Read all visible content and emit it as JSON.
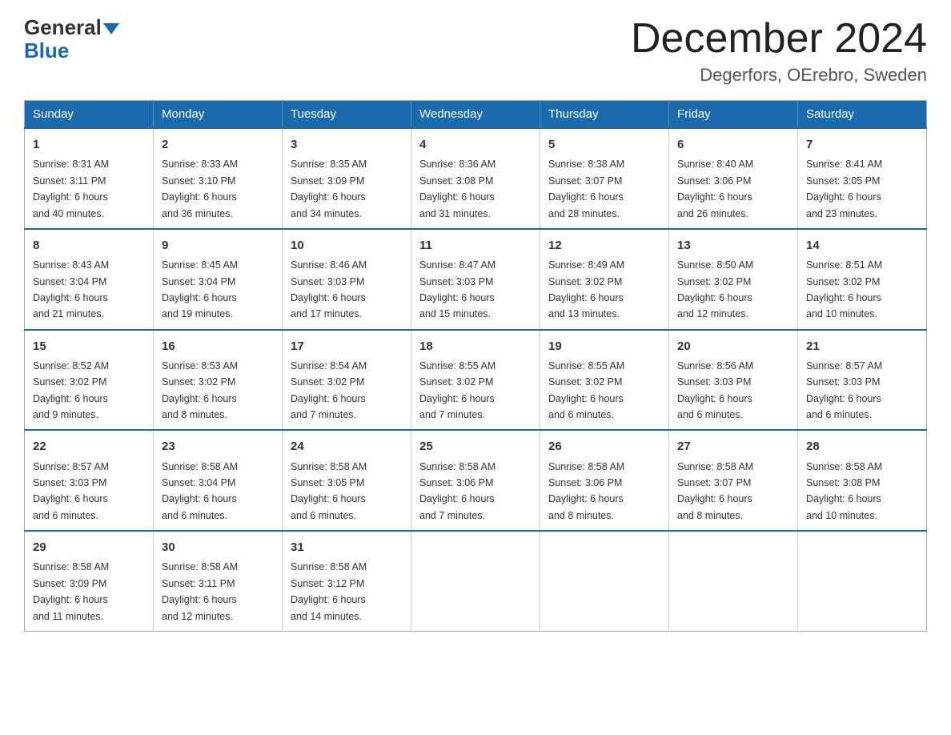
{
  "header": {
    "logo_general": "General",
    "logo_blue": "Blue",
    "month_title": "December 2024",
    "location": "Degerfors, OErebro, Sweden"
  },
  "days_of_week": [
    "Sunday",
    "Monday",
    "Tuesday",
    "Wednesday",
    "Thursday",
    "Friday",
    "Saturday"
  ],
  "weeks": [
    [
      {
        "day": "1",
        "sunrise": "8:31 AM",
        "sunset": "3:11 PM",
        "daylight": "6 hours and 40 minutes."
      },
      {
        "day": "2",
        "sunrise": "8:33 AM",
        "sunset": "3:10 PM",
        "daylight": "6 hours and 36 minutes."
      },
      {
        "day": "3",
        "sunrise": "8:35 AM",
        "sunset": "3:09 PM",
        "daylight": "6 hours and 34 minutes."
      },
      {
        "day": "4",
        "sunrise": "8:36 AM",
        "sunset": "3:08 PM",
        "daylight": "6 hours and 31 minutes."
      },
      {
        "day": "5",
        "sunrise": "8:38 AM",
        "sunset": "3:07 PM",
        "daylight": "6 hours and 28 minutes."
      },
      {
        "day": "6",
        "sunrise": "8:40 AM",
        "sunset": "3:06 PM",
        "daylight": "6 hours and 26 minutes."
      },
      {
        "day": "7",
        "sunrise": "8:41 AM",
        "sunset": "3:05 PM",
        "daylight": "6 hours and 23 minutes."
      }
    ],
    [
      {
        "day": "8",
        "sunrise": "8:43 AM",
        "sunset": "3:04 PM",
        "daylight": "6 hours and 21 minutes."
      },
      {
        "day": "9",
        "sunrise": "8:45 AM",
        "sunset": "3:04 PM",
        "daylight": "6 hours and 19 minutes."
      },
      {
        "day": "10",
        "sunrise": "8:46 AM",
        "sunset": "3:03 PM",
        "daylight": "6 hours and 17 minutes."
      },
      {
        "day": "11",
        "sunrise": "8:47 AM",
        "sunset": "3:03 PM",
        "daylight": "6 hours and 15 minutes."
      },
      {
        "day": "12",
        "sunrise": "8:49 AM",
        "sunset": "3:02 PM",
        "daylight": "6 hours and 13 minutes."
      },
      {
        "day": "13",
        "sunrise": "8:50 AM",
        "sunset": "3:02 PM",
        "daylight": "6 hours and 12 minutes."
      },
      {
        "day": "14",
        "sunrise": "8:51 AM",
        "sunset": "3:02 PM",
        "daylight": "6 hours and 10 minutes."
      }
    ],
    [
      {
        "day": "15",
        "sunrise": "8:52 AM",
        "sunset": "3:02 PM",
        "daylight": "6 hours and 9 minutes."
      },
      {
        "day": "16",
        "sunrise": "8:53 AM",
        "sunset": "3:02 PM",
        "daylight": "6 hours and 8 minutes."
      },
      {
        "day": "17",
        "sunrise": "8:54 AM",
        "sunset": "3:02 PM",
        "daylight": "6 hours and 7 minutes."
      },
      {
        "day": "18",
        "sunrise": "8:55 AM",
        "sunset": "3:02 PM",
        "daylight": "6 hours and 7 minutes."
      },
      {
        "day": "19",
        "sunrise": "8:55 AM",
        "sunset": "3:02 PM",
        "daylight": "6 hours and 6 minutes."
      },
      {
        "day": "20",
        "sunrise": "8:56 AM",
        "sunset": "3:03 PM",
        "daylight": "6 hours and 6 minutes."
      },
      {
        "day": "21",
        "sunrise": "8:57 AM",
        "sunset": "3:03 PM",
        "daylight": "6 hours and 6 minutes."
      }
    ],
    [
      {
        "day": "22",
        "sunrise": "8:57 AM",
        "sunset": "3:03 PM",
        "daylight": "6 hours and 6 minutes."
      },
      {
        "day": "23",
        "sunrise": "8:58 AM",
        "sunset": "3:04 PM",
        "daylight": "6 hours and 6 minutes."
      },
      {
        "day": "24",
        "sunrise": "8:58 AM",
        "sunset": "3:05 PM",
        "daylight": "6 hours and 6 minutes."
      },
      {
        "day": "25",
        "sunrise": "8:58 AM",
        "sunset": "3:06 PM",
        "daylight": "6 hours and 7 minutes."
      },
      {
        "day": "26",
        "sunrise": "8:58 AM",
        "sunset": "3:06 PM",
        "daylight": "6 hours and 8 minutes."
      },
      {
        "day": "27",
        "sunrise": "8:58 AM",
        "sunset": "3:07 PM",
        "daylight": "6 hours and 8 minutes."
      },
      {
        "day": "28",
        "sunrise": "8:58 AM",
        "sunset": "3:08 PM",
        "daylight": "6 hours and 10 minutes."
      }
    ],
    [
      {
        "day": "29",
        "sunrise": "8:58 AM",
        "sunset": "3:09 PM",
        "daylight": "6 hours and 11 minutes."
      },
      {
        "day": "30",
        "sunrise": "8:58 AM",
        "sunset": "3:11 PM",
        "daylight": "6 hours and 12 minutes."
      },
      {
        "day": "31",
        "sunrise": "8:58 AM",
        "sunset": "3:12 PM",
        "daylight": "6 hours and 14 minutes."
      },
      null,
      null,
      null,
      null
    ]
  ],
  "labels": {
    "sunrise": "Sunrise:",
    "sunset": "Sunset:",
    "daylight": "Daylight:"
  }
}
